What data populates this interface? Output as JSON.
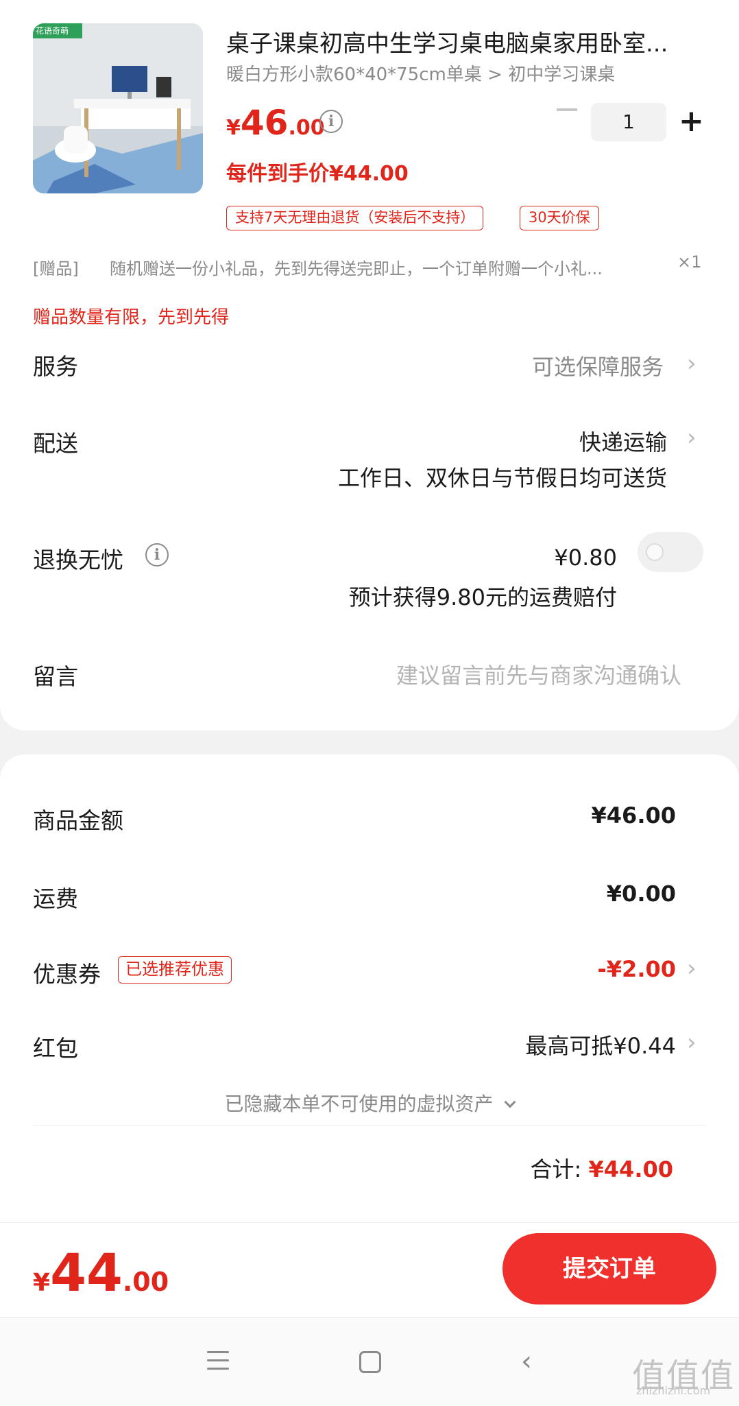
{
  "product": {
    "title": "桌子课桌初高中生学习桌电脑桌家用卧室...",
    "spec": "暖白方形小款60*40*75cm单桌 > 初中学习课桌",
    "thumb_logo": "花语奇萌",
    "price_currency": "¥",
    "price_integer": "46",
    "price_decimal": ".00",
    "info_glyph": "i",
    "deal_price": "每件到手价¥44.00",
    "quantity": "1",
    "minus_icon": "minus-icon",
    "plus_label": "+",
    "tags": [
      "支持7天无理由退货（安装后不支持）",
      "30天价保"
    ]
  },
  "gift": {
    "label": "[赠品]",
    "text": "随机赠送一份小礼品，先到先得送完即止，一个订单附赠一个小礼...",
    "qty": "×1",
    "warning": "赠品数量有限，先到先得"
  },
  "service": {
    "label": "服务",
    "value": "可选保障服务"
  },
  "delivery": {
    "label": "配送",
    "value": "快递运输",
    "note": "工作日、双休日与节假日均可送货"
  },
  "return_worry": {
    "label": "退换无忧",
    "price": "¥0.80",
    "note": "预计获得9.80元的运费赔付",
    "toggle_on": false
  },
  "message": {
    "label": "留言",
    "placeholder": "建议留言前先与商家沟通确认"
  },
  "summary": {
    "goods_amount_label": "商品金额",
    "goods_amount": "¥46.00",
    "shipping_label": "运费",
    "shipping": "¥0.00",
    "coupon_label": "优惠券",
    "coupon_badge": "已选推荐优惠",
    "coupon_value": "-¥2.00",
    "red_packet_label": "红包",
    "red_packet_value": "最高可抵¥0.44",
    "hidden_assets": "已隐藏本单不可使用的虚拟资产",
    "total_label": "合计:",
    "total_value": "¥44.00"
  },
  "bottom": {
    "currency": "¥",
    "integer": "44",
    "decimal": ".00",
    "submit_label": "提交订单"
  },
  "chevron": "›",
  "watermark": {
    "text": "值值值",
    "url": "zhizhizhi.com"
  },
  "nav": {
    "back_glyph": "‹"
  },
  "colors": {
    "accent": "#e0251b",
    "submit": "#f0302c",
    "muted": "#8a8a8a"
  }
}
